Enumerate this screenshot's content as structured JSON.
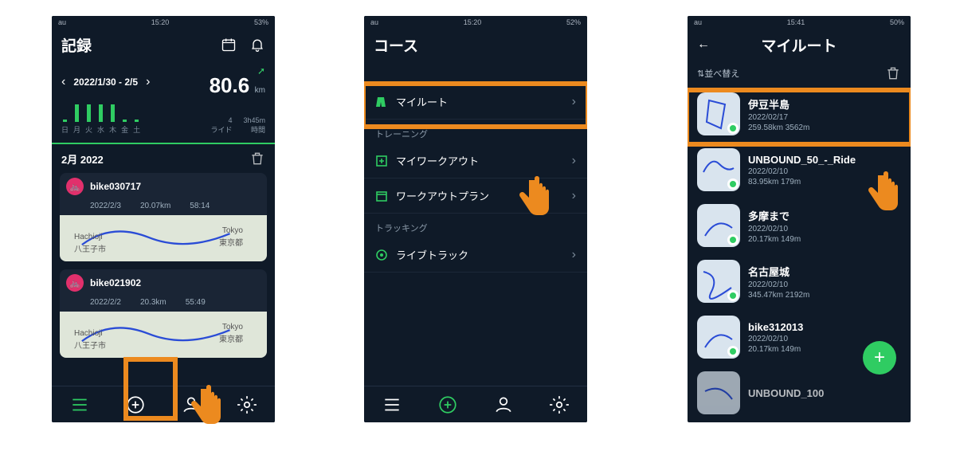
{
  "status": {
    "carrier": "au",
    "time1": "15:20",
    "time2": "15:20",
    "time3": "15:41",
    "batt1": "53%",
    "batt2": "52%",
    "batt3": "50%"
  },
  "p1": {
    "title": "記録",
    "date_range": "2022/1/30 - 2/5",
    "distance": "80.6",
    "unit": "km",
    "rides_n": "4",
    "rides_l": "ライド",
    "time_n": "3h45m",
    "time_l": "時間",
    "days": [
      "日",
      "月",
      "火",
      "水",
      "木",
      "金",
      "土"
    ],
    "month": "2月 2022",
    "rides": [
      {
        "name": "bike030717",
        "date": "2022/2/3",
        "dist": "20.07km",
        "dur": "58:14"
      },
      {
        "name": "bike021902",
        "date": "2022/2/2",
        "dist": "20.3km",
        "dur": "55:49"
      }
    ],
    "map_labels": [
      "Hachioji",
      "八王子市",
      "Tokyo",
      "東京都"
    ]
  },
  "p2": {
    "title": "コース",
    "items": [
      {
        "label": "マイルート"
      },
      {
        "label": "マイワークアウト"
      },
      {
        "label": "ワークアウトプラン"
      },
      {
        "label": "ライブトラック"
      }
    ],
    "sec_training": "トレーニング",
    "sec_tracking": "トラッキング"
  },
  "p3": {
    "title": "マイルート",
    "sort": "並べ替え",
    "routes": [
      {
        "name": "伊豆半島",
        "date": "2022/02/17",
        "stats": "259.58km 3562m"
      },
      {
        "name": "UNBOUND_50_-_Ride",
        "date": "2022/02/10",
        "stats": "83.95km 179m"
      },
      {
        "name": "多摩まで",
        "date": "2022/02/10",
        "stats": "20.17km 149m"
      },
      {
        "name": "名古屋城",
        "date": "2022/02/10",
        "stats": "345.47km 2192m"
      },
      {
        "name": "bike312013",
        "date": "2022/02/10",
        "stats": "20.17km 149m"
      },
      {
        "name": "UNBOUND_100",
        "date": "",
        "stats": ""
      }
    ]
  }
}
